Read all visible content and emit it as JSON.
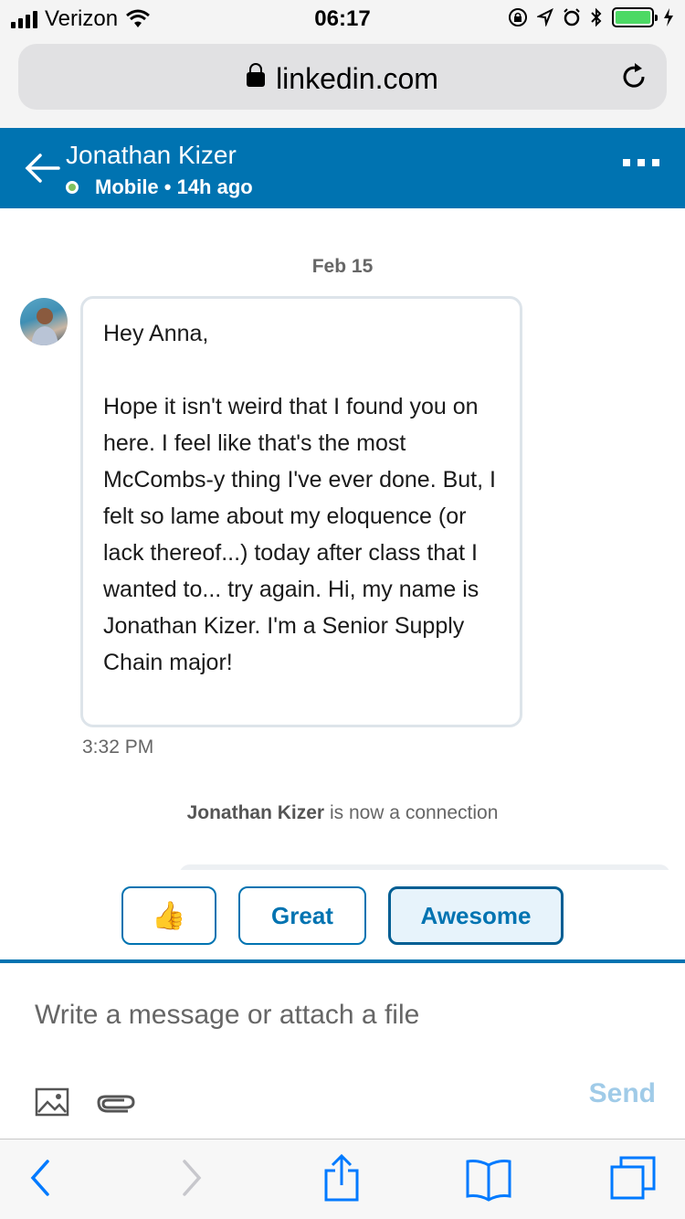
{
  "status_bar": {
    "carrier": "Verizon",
    "time": "06:17"
  },
  "browser": {
    "url": "linkedin.com"
  },
  "header": {
    "contact_name": "Jonathan Kizer",
    "status_text": "Mobile • 14h ago"
  },
  "conversation": {
    "date_separator": "Feb 15",
    "message_text": "Hey Anna,\n\nHope it isn't weird that I found you on here. I feel like that's the most McCombs-y thing I've ever done. But, I felt so lame about my eloquence (or lack thereof...) today after class that I wanted to... try again. Hi, my name is Jonathan Kizer. I'm a Senior Supply Chain major!",
    "message_time": "3:32 PM",
    "connection_name": "Jonathan Kizer",
    "connection_text": " is now a connection"
  },
  "quick_replies": {
    "thumbs_up": "👍",
    "great": "Great",
    "awesome": "Awesome",
    "selected": "Awesome"
  },
  "composer": {
    "placeholder": "Write a message or attach a file",
    "value": "",
    "send_label": "Send"
  },
  "colors": {
    "linkedin_blue": "#0073b1",
    "online_green": "#7fc15e",
    "send_disabled": "#a0cbe8",
    "safari_blue": "#007aff"
  }
}
